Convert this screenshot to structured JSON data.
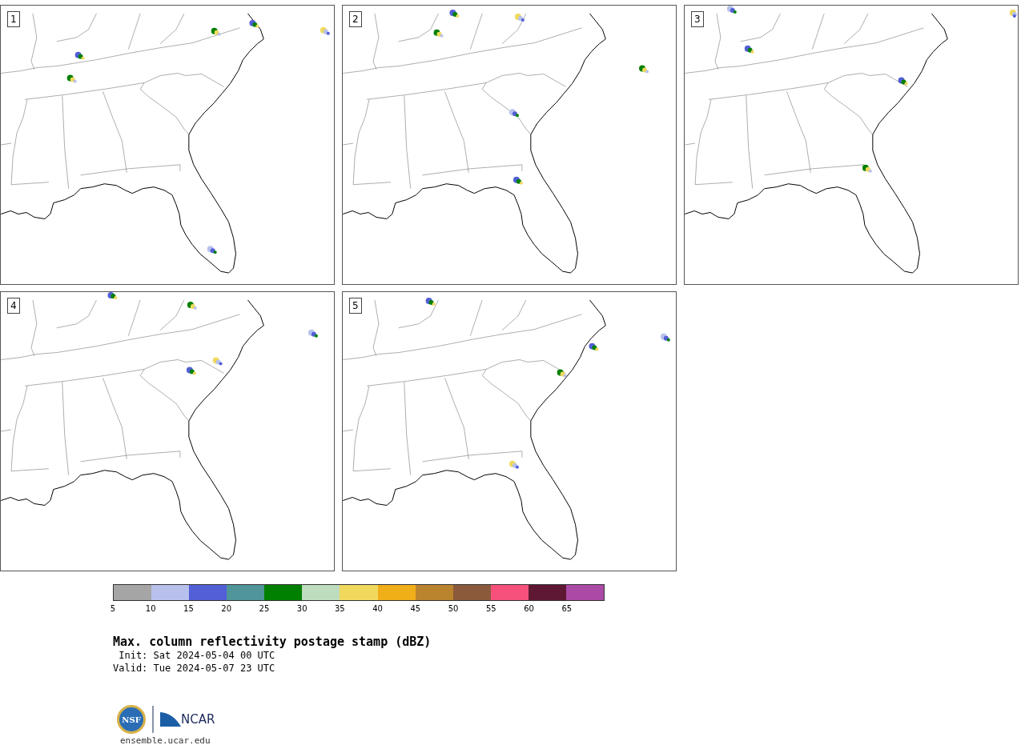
{
  "panels": [
    {
      "label": "1"
    },
    {
      "label": "2"
    },
    {
      "label": "3"
    },
    {
      "label": "4"
    },
    {
      "label": "5"
    }
  ],
  "colorbar": {
    "bins": [
      {
        "color": "#a5a5a5"
      },
      {
        "color": "#b7c1ec"
      },
      {
        "color": "#525fd6"
      },
      {
        "color": "#4f959a"
      },
      {
        "color": "#008000"
      },
      {
        "color": "#bedcbe"
      },
      {
        "color": "#f0d95c"
      },
      {
        "color": "#f0ae19"
      },
      {
        "color": "#ba842f"
      },
      {
        "color": "#8b5a3c"
      },
      {
        "color": "#f5517c"
      },
      {
        "color": "#5f1834"
      },
      {
        "color": "#ab4aa6"
      }
    ],
    "ticks": [
      "5",
      "10",
      "15",
      "20",
      "25",
      "30",
      "35",
      "40",
      "45",
      "50",
      "55",
      "60",
      "65"
    ]
  },
  "title": "Max. column reflectivity postage stamp (dBZ)",
  "init": " Init: Sat 2024-05-04 00 UTC",
  "valid": "Valid: Tue 2024-05-07 23 UTC",
  "logo": {
    "seal_text": "NSF",
    "org_text": "NCAR"
  },
  "footer": "ensemble.ucar.edu"
}
